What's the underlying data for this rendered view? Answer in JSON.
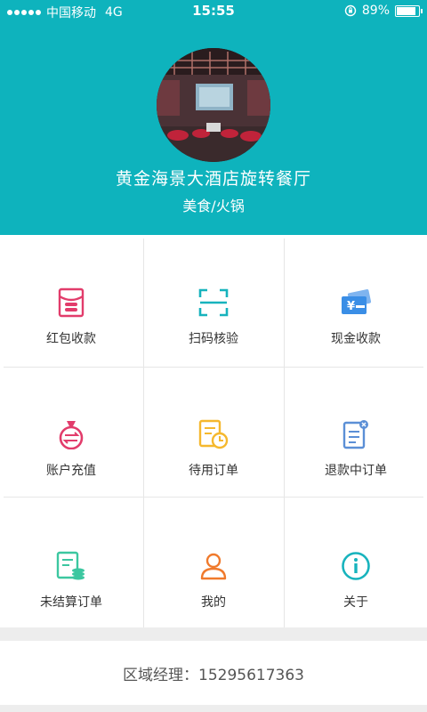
{
  "status_bar": {
    "carrier": "中国移动",
    "network": "4G",
    "time": "15:55",
    "battery": "89%"
  },
  "profile": {
    "name": "黄金海景大酒店旋转餐厅",
    "category": "美食/火锅"
  },
  "menu": [
    {
      "label": "红包收款",
      "icon": "red-envelope-icon",
      "color": "#e23c6b"
    },
    {
      "label": "扫码核验",
      "icon": "scan-icon",
      "color": "#17b3bd"
    },
    {
      "label": "现金收款",
      "icon": "cash-icon",
      "color": "#3a8ee6"
    },
    {
      "label": "账户充值",
      "icon": "money-bag-icon",
      "color": "#e23c6b"
    },
    {
      "label": "待用订单",
      "icon": "pending-order-icon",
      "color": "#f5b82e"
    },
    {
      "label": "退款中订单",
      "icon": "refund-order-icon",
      "color": "#5b8fd6"
    },
    {
      "label": "未结算订单",
      "icon": "unsettled-order-icon",
      "color": "#3cc7a0"
    },
    {
      "label": "我的",
      "icon": "user-icon",
      "color": "#f07a2c"
    },
    {
      "label": "关于",
      "icon": "info-icon",
      "color": "#17b3bd"
    }
  ],
  "footer": {
    "text": "区域经理：15295617363"
  }
}
